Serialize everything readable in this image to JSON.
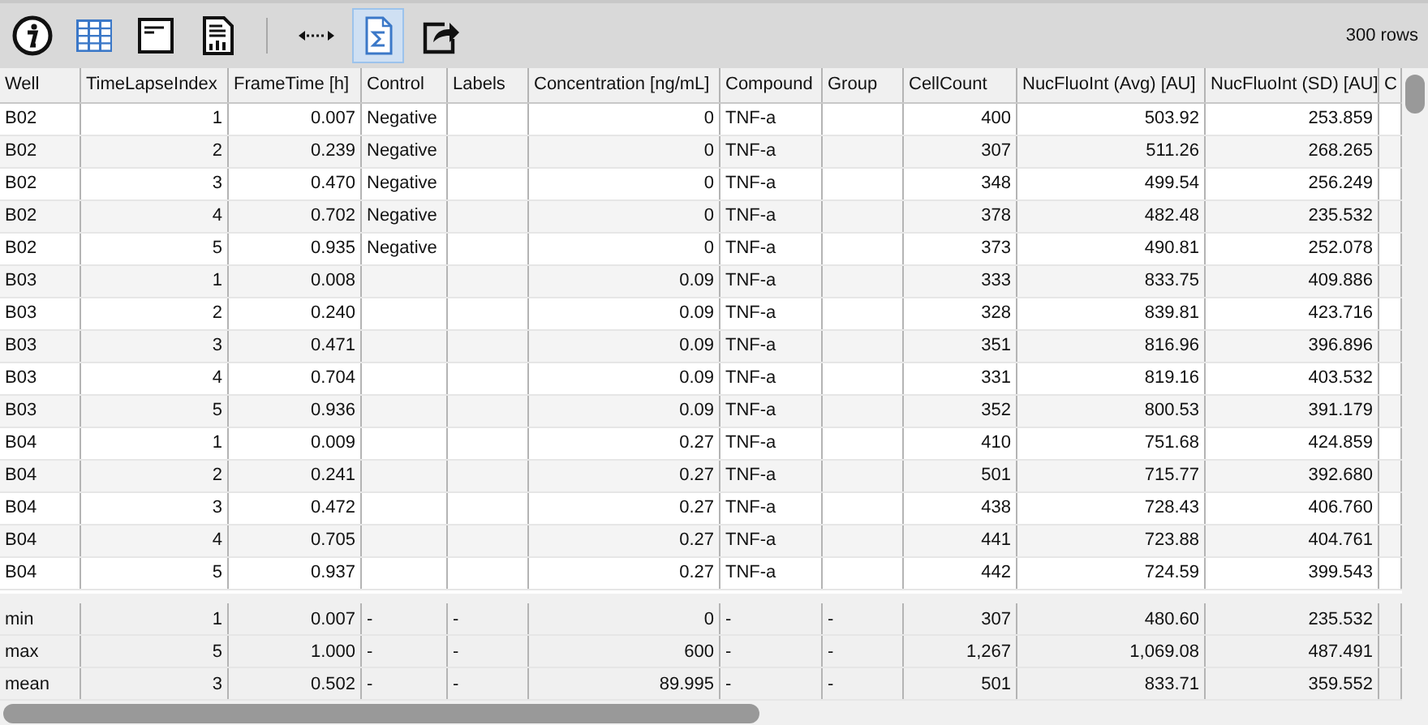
{
  "toolbar": {
    "buttons": [
      {
        "kind": "info",
        "selected": false
      },
      {
        "kind": "grid",
        "selected": false
      },
      {
        "kind": "window",
        "selected": false
      },
      {
        "kind": "report",
        "selected": false
      },
      {
        "kind": "separator"
      },
      {
        "kind": "resize",
        "selected": false
      },
      {
        "kind": "sum",
        "selected": true
      },
      {
        "kind": "export",
        "selected": false
      }
    ],
    "row_count": "300 rows"
  },
  "table": {
    "columns": [
      {
        "label": "Well",
        "kind": "text"
      },
      {
        "label": "TimeLapseIndex",
        "kind": "number"
      },
      {
        "label": "FrameTime [h]",
        "kind": "number"
      },
      {
        "label": "Control",
        "kind": "text"
      },
      {
        "label": "Labels",
        "kind": "text"
      },
      {
        "label": "Concentration [ng/mL]",
        "kind": "number"
      },
      {
        "label": "Compound",
        "kind": "text"
      },
      {
        "label": "Group",
        "kind": "text"
      },
      {
        "label": "CellCount",
        "kind": "number"
      },
      {
        "label": "NucFluoInt (Avg) [AU]",
        "kind": "number"
      },
      {
        "label": "NucFluoInt (SD) [AU]",
        "kind": "number"
      },
      {
        "label": "C",
        "kind": "text"
      }
    ],
    "rows": [
      [
        "B02",
        "1",
        "0.007",
        "Negative",
        null,
        "0",
        "TNF-a",
        null,
        "400",
        "503.92",
        "253.859"
      ],
      [
        "B02",
        "2",
        "0.239",
        "Negative",
        null,
        "0",
        "TNF-a",
        null,
        "307",
        "511.26",
        "268.265"
      ],
      [
        "B02",
        "3",
        "0.470",
        "Negative",
        null,
        "0",
        "TNF-a",
        null,
        "348",
        "499.54",
        "256.249"
      ],
      [
        "B02",
        "4",
        "0.702",
        "Negative",
        null,
        "0",
        "TNF-a",
        null,
        "378",
        "482.48",
        "235.532"
      ],
      [
        "B02",
        "5",
        "0.935",
        "Negative",
        null,
        "0",
        "TNF-a",
        null,
        "373",
        "490.81",
        "252.078"
      ],
      [
        "B03",
        "1",
        "0.008",
        null,
        null,
        "0.09",
        "TNF-a",
        null,
        "333",
        "833.75",
        "409.886"
      ],
      [
        "B03",
        "2",
        "0.240",
        null,
        null,
        "0.09",
        "TNF-a",
        null,
        "328",
        "839.81",
        "423.716"
      ],
      [
        "B03",
        "3",
        "0.471",
        null,
        null,
        "0.09",
        "TNF-a",
        null,
        "351",
        "816.96",
        "396.896"
      ],
      [
        "B03",
        "4",
        "0.704",
        null,
        null,
        "0.09",
        "TNF-a",
        null,
        "331",
        "819.16",
        "403.532"
      ],
      [
        "B03",
        "5",
        "0.936",
        null,
        null,
        "0.09",
        "TNF-a",
        null,
        "352",
        "800.53",
        "391.179"
      ],
      [
        "B04",
        "1",
        "0.009",
        null,
        null,
        "0.27",
        "TNF-a",
        null,
        "410",
        "751.68",
        "424.859"
      ],
      [
        "B04",
        "2",
        "0.241",
        null,
        null,
        "0.27",
        "TNF-a",
        null,
        "501",
        "715.77",
        "392.680"
      ],
      [
        "B04",
        "3",
        "0.472",
        null,
        null,
        "0.27",
        "TNF-a",
        null,
        "438",
        "728.43",
        "406.760"
      ],
      [
        "B04",
        "4",
        "0.705",
        null,
        null,
        "0.27",
        "TNF-a",
        null,
        "441",
        "723.88",
        "404.761"
      ],
      [
        "B04",
        "5",
        "0.937",
        null,
        null,
        "0.27",
        "TNF-a",
        null,
        "442",
        "724.59",
        "399.543"
      ]
    ],
    "summary": [
      [
        "min",
        "1",
        "0.007",
        "-",
        "-",
        "0",
        "-",
        "-",
        "307",
        "480.60",
        "235.532"
      ],
      [
        "max",
        "5",
        "1.000",
        "-",
        "-",
        "600",
        "-",
        "-",
        "1,267",
        "1,069.08",
        "487.491"
      ],
      [
        "mean",
        "3",
        "0.502",
        "-",
        "-",
        "89.995",
        "-",
        "-",
        "501",
        "833.71",
        "359.552"
      ]
    ]
  }
}
